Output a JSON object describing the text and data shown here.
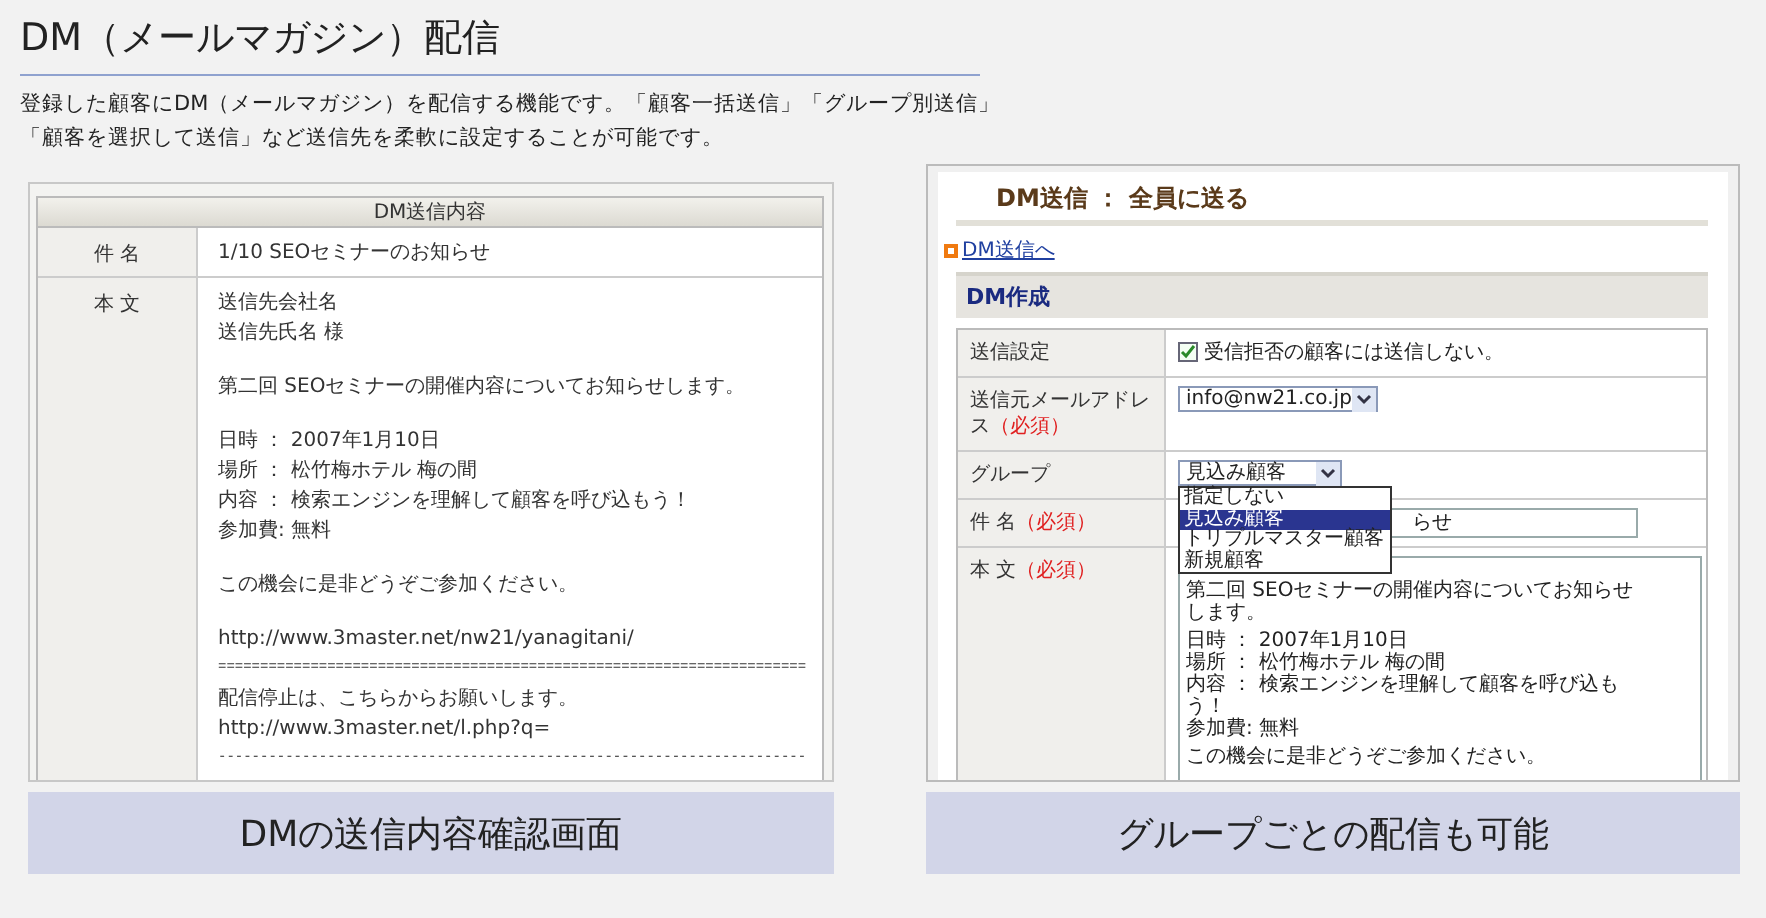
{
  "page_title": "DM（メールマガジン）配信",
  "description": [
    "登録した顧客にDM（メールマガジン）を配信する機能です。「顧客一括送信」「グループ別送信」",
    "「顧客を選択して送信」など送信先を柔軟に設定することが可能です。"
  ],
  "confirm_screen": {
    "header": "DM送信内容",
    "subject": {
      "label": "件 名",
      "value": "1/10  SEOセミナーのお知らせ"
    },
    "body": {
      "label": "本 文",
      "paragraphs": [
        [
          "送信先会社名",
          "送信先氏名 様"
        ],
        [
          "第二回  SEOセミナーの開催内容についてお知らせします。"
        ],
        [
          "日時 ： 2007年1月10日",
          "場所 ： 松竹梅ホテル  梅の間",
          "内容 ： 検索エンジンを理解して顧客を呼び込もう！",
          "参加費:  無料"
        ],
        [
          "この機会に是非どうぞご参加ください。"
        ],
        [
          "http://www.3master.net/nw21/yanagitani/",
          "======================================================================",
          "配信停止は、こちらからお願いします。",
          "http://www.3master.net/l.php?q=",
          "----------------------------------------------------------------------"
        ]
      ]
    },
    "caption": "DMの送信内容確認画面"
  },
  "form_screen": {
    "title": "DM送信 ： 全員に送る",
    "link": "DM送信へ",
    "section": "DM作成",
    "rows": [
      {
        "kind": "checkbox",
        "label": "送信設定",
        "checked": true,
        "text": "受信拒否の顧客には送信しない。"
      },
      {
        "kind": "select",
        "label": "送信元メールアドレス",
        "required": "（必須）",
        "value": "info@nw21.co.jp"
      },
      {
        "kind": "group",
        "label": "グループ",
        "value": "見込み顧客",
        "options": [
          {
            "label": "指定しない",
            "selected": false
          },
          {
            "label": "見込み顧客",
            "selected": true
          },
          {
            "label": "トリプルマスター顧客",
            "selected": false
          },
          {
            "label": "新規顧客",
            "selected": false
          }
        ]
      },
      {
        "kind": "input",
        "label": "件 名",
        "required": "（必須）",
        "value": "らせ"
      },
      {
        "kind": "textarea",
        "label": "本 文",
        "required": "（必須）",
        "paragraphs": [
          [
            "第二回 SEOセミナーの開催内容についてお知らせ",
            "します。"
          ],
          [
            "日時 ： 2007年1月10日",
            "場所 ： 松竹梅ホテル  梅の間",
            "内容 ： 検索エンジンを理解して顧客を呼び込も",
            "う！",
            "参加費:  無料"
          ],
          [
            "この機会に是非どうぞご参加ください。"
          ]
        ]
      }
    ],
    "caption": "グループごとの配信も可能"
  }
}
